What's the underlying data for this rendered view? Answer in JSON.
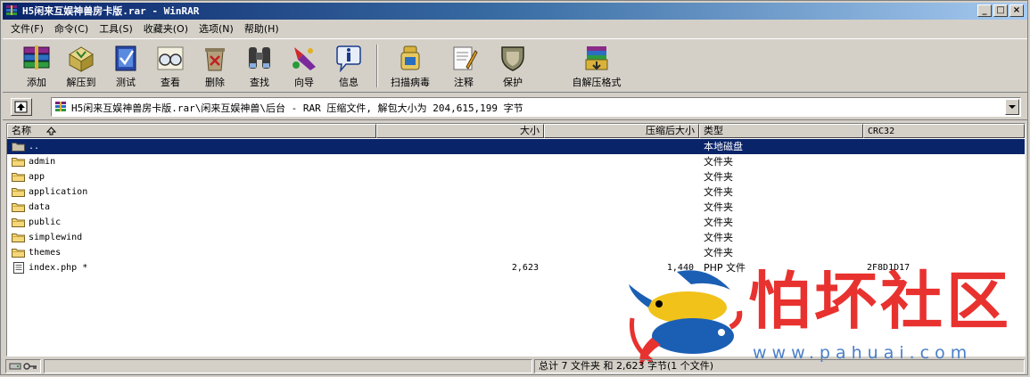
{
  "window": {
    "title": "H5闲来互娱神兽房卡版.rar - WinRAR",
    "buttons": {
      "minimize": "_",
      "maximize": "□",
      "close": "×"
    }
  },
  "menu": [
    "文件(F)",
    "命令(C)",
    "工具(S)",
    "收藏夹(O)",
    "选项(N)",
    "帮助(H)"
  ],
  "toolbar": [
    {
      "id": "add",
      "label": "添加",
      "icon": "books-add-icon"
    },
    {
      "id": "extract",
      "label": "解压到",
      "icon": "extract-icon"
    },
    {
      "id": "test",
      "label": "测试",
      "icon": "test-icon"
    },
    {
      "id": "view",
      "label": "查看",
      "icon": "glasses-icon"
    },
    {
      "id": "delete",
      "label": "删除",
      "icon": "delete-icon"
    },
    {
      "id": "find",
      "label": "查找",
      "icon": "binoculars-icon"
    },
    {
      "id": "wizard",
      "label": "向导",
      "icon": "wizard-icon"
    },
    {
      "id": "info",
      "label": "信息",
      "icon": "info-icon"
    },
    {
      "id": "scan",
      "label": "扫描病毒",
      "icon": "scan-icon"
    },
    {
      "id": "comment",
      "label": "注释",
      "icon": "comment-icon"
    },
    {
      "id": "protect",
      "label": "保护",
      "icon": "shield-icon"
    },
    {
      "id": "sfx",
      "label": "自解压格式",
      "icon": "sfx-icon"
    }
  ],
  "address": {
    "path": "H5闲来互娱神兽房卡版.rar\\闲来互娱神兽\\后台 - RAR 压缩文件, 解包大小为 204,615,199 字节"
  },
  "columns": {
    "name": "名称",
    "size": "大小",
    "packed": "压缩后大小",
    "type": "类型",
    "crc": "CRC32"
  },
  "files": [
    {
      "name": "..",
      "size": "",
      "packed": "",
      "type": "本地磁盘",
      "crc": "",
      "kind": "up",
      "selected": true
    },
    {
      "name": "admin",
      "size": "",
      "packed": "",
      "type": "文件夹",
      "crc": "",
      "kind": "folder",
      "selected": false
    },
    {
      "name": "app",
      "size": "",
      "packed": "",
      "type": "文件夹",
      "crc": "",
      "kind": "folder",
      "selected": false
    },
    {
      "name": "application",
      "size": "",
      "packed": "",
      "type": "文件夹",
      "crc": "",
      "kind": "folder",
      "selected": false
    },
    {
      "name": "data",
      "size": "",
      "packed": "",
      "type": "文件夹",
      "crc": "",
      "kind": "folder",
      "selected": false
    },
    {
      "name": "public",
      "size": "",
      "packed": "",
      "type": "文件夹",
      "crc": "",
      "kind": "folder",
      "selected": false
    },
    {
      "name": "simplewind",
      "size": "",
      "packed": "",
      "type": "文件夹",
      "crc": "",
      "kind": "folder",
      "selected": false
    },
    {
      "name": "themes",
      "size": "",
      "packed": "",
      "type": "文件夹",
      "crc": "",
      "kind": "folder",
      "selected": false
    },
    {
      "name": "index.php *",
      "size": "2,623",
      "packed": "1,440",
      "type": "PHP 文件",
      "crc": "2F8D1D17",
      "kind": "file",
      "selected": false
    }
  ],
  "status": {
    "summary": "总计 7 文件夹 和 2,623 字节(1 个文件)"
  },
  "watermark": {
    "text": "怕坏社区",
    "url": "www.pahuai.com"
  },
  "colors": {
    "title_start": "#0a246a",
    "selection": "#0a246a",
    "folder": "#f5d77a",
    "watermark_red": "#e8322f",
    "watermark_blue": "#4a7fc8"
  }
}
